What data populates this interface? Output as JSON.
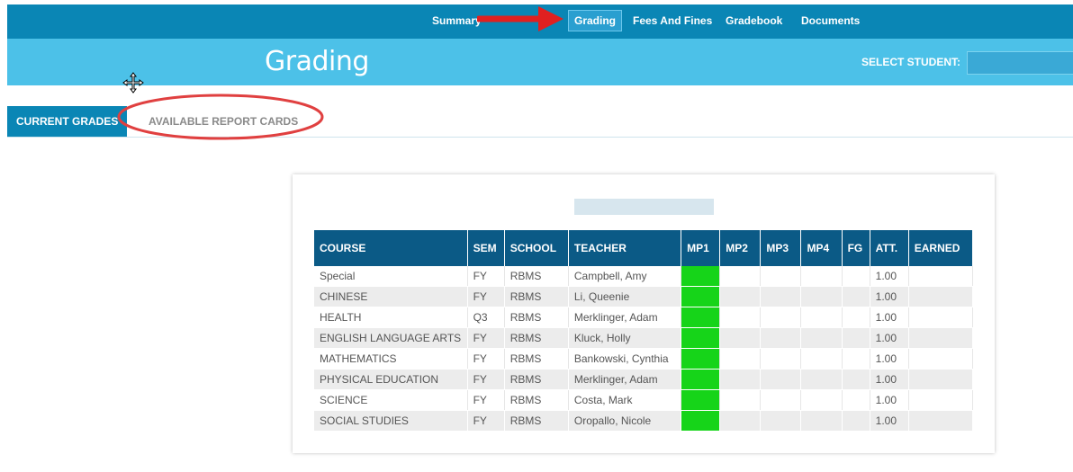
{
  "nav": {
    "items": [
      {
        "label": "Summary"
      },
      {
        "label": "Grading"
      },
      {
        "label": "Fees And Fines"
      },
      {
        "label": "Gradebook"
      },
      {
        "label": "Documents"
      }
    ],
    "active": "Grading"
  },
  "title": "Grading",
  "select_student_label": "SELECT STUDENT:",
  "tabs": [
    {
      "label": "CURRENT GRADES"
    },
    {
      "label": "AVAILABLE REPORT CARDS"
    }
  ],
  "table": {
    "headers": [
      "COURSE",
      "SEM",
      "SCHOOL",
      "TEACHER",
      "MP1",
      "MP2",
      "MP3",
      "MP4",
      "FG",
      "ATT.",
      "EARNED"
    ],
    "rows": [
      {
        "course": "Special",
        "sem": "FY",
        "school": "RBMS",
        "teacher": "Campbell, Amy",
        "att": "1.00"
      },
      {
        "course": "CHINESE",
        "sem": "FY",
        "school": "RBMS",
        "teacher": "Li, Queenie",
        "att": "1.00"
      },
      {
        "course": "HEALTH",
        "sem": "Q3",
        "school": "RBMS",
        "teacher": "Merklinger, Adam",
        "att": "1.00"
      },
      {
        "course": "ENGLISH LANGUAGE ARTS",
        "sem": "FY",
        "school": "RBMS",
        "teacher": "Kluck, Holly",
        "att": "1.00"
      },
      {
        "course": "MATHEMATICS",
        "sem": "FY",
        "school": "RBMS",
        "teacher": "Bankowski, Cynthia",
        "att": "1.00"
      },
      {
        "course": "PHYSICAL EDUCATION",
        "sem": "FY",
        "school": "RBMS",
        "teacher": "Merklinger, Adam",
        "att": "1.00"
      },
      {
        "course": "SCIENCE",
        "sem": "FY",
        "school": "RBMS",
        "teacher": "Costa, Mark",
        "att": "1.00"
      },
      {
        "course": "SOCIAL STUDIES",
        "sem": "FY",
        "school": "RBMS",
        "teacher": "Oropallo, Nicole",
        "att": "1.00"
      }
    ]
  },
  "colors": {
    "nav_bg": "#0a86b5",
    "title_bg": "#4cc1e8",
    "header_bg": "#0b5a86",
    "grade_fill": "#16d419",
    "annotation": "#e02020"
  }
}
